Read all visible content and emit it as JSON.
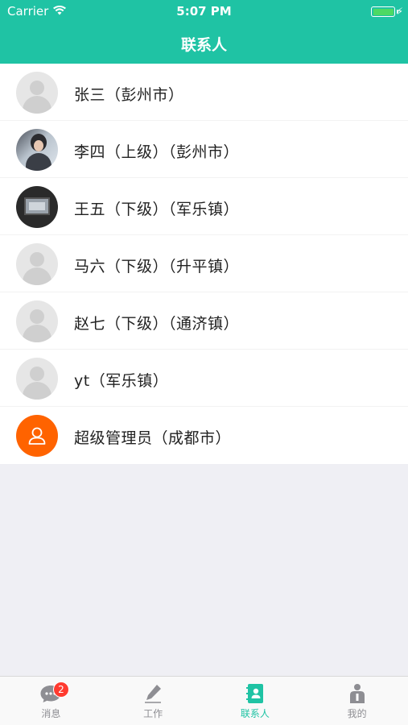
{
  "status": {
    "carrier": "Carrier",
    "time": "5:07 PM"
  },
  "nav": {
    "title": "联系人"
  },
  "contacts": [
    {
      "name": "张三（彭州市）",
      "avatar": "default-avatar"
    },
    {
      "name": "李四（上级）（彭州市）",
      "avatar": "photo-avatar"
    },
    {
      "name": "王五（下级）（军乐镇）",
      "avatar": "photo-avatar"
    },
    {
      "name": "马六（下级）（升平镇）",
      "avatar": "default-avatar"
    },
    {
      "name": "赵七（下级）（通济镇）",
      "avatar": "default-avatar"
    },
    {
      "name": "yt（军乐镇）",
      "avatar": "default-avatar"
    },
    {
      "name": "超级管理员（成都市）",
      "avatar": "person-outline-avatar"
    }
  ],
  "tabs": [
    {
      "label": "消息",
      "icon": "chat-icon",
      "badge": "2",
      "active": false
    },
    {
      "label": "工作",
      "icon": "pen-icon",
      "active": false
    },
    {
      "label": "联系人",
      "icon": "contacts-book-icon",
      "active": true
    },
    {
      "label": "我的",
      "icon": "person-info-icon",
      "active": false
    }
  ],
  "colors": {
    "accent": "#1fc3a4",
    "badge": "#ff3b30",
    "admin_avatar": "#ff6300"
  }
}
